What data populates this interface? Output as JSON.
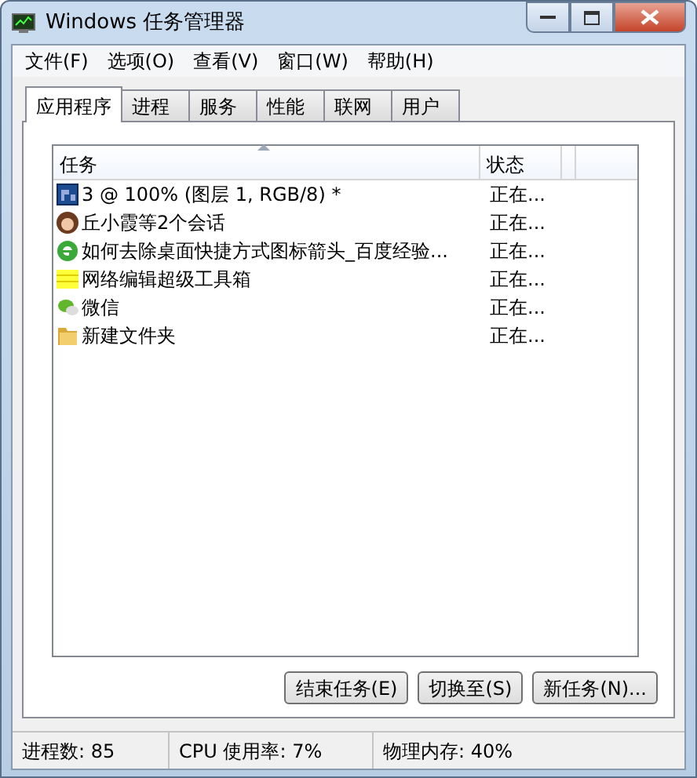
{
  "window": {
    "title": "Windows 任务管理器"
  },
  "menu": [
    "文件(F)",
    "选项(O)",
    "查看(V)",
    "窗口(W)",
    "帮助(H)"
  ],
  "tabs": [
    {
      "label": "应用程序",
      "selected": true
    },
    {
      "label": "进程",
      "selected": false
    },
    {
      "label": "服务",
      "selected": false
    },
    {
      "label": "性能",
      "selected": false
    },
    {
      "label": "联网",
      "selected": false
    },
    {
      "label": "用户",
      "selected": false
    }
  ],
  "table": {
    "columns": [
      "任务",
      "状态"
    ],
    "rows": [
      {
        "kind": "photoshop",
        "task": "3 @ 100% (图层 1, RGB/8) *",
        "status": "正在..."
      },
      {
        "kind": "avatar",
        "task": "丘小霞等2个会话",
        "status": "正在..."
      },
      {
        "kind": "browser",
        "task": "如何去除桌面快捷方式图标箭头_百度经验...",
        "status": "正在..."
      },
      {
        "kind": "toolbox",
        "task": "网络编辑超级工具箱",
        "status": "正在..."
      },
      {
        "kind": "chat",
        "task": "微信",
        "status": "正在..."
      },
      {
        "kind": "folder",
        "task": "新建文件夹",
        "status": "正在..."
      }
    ]
  },
  "buttons": [
    "结束任务(E)",
    "切换至(S)",
    "新任务(N)..."
  ],
  "status_bar": [
    "进程数: 85",
    "CPU 使用率: 7%",
    "物理内存: 40%"
  ]
}
